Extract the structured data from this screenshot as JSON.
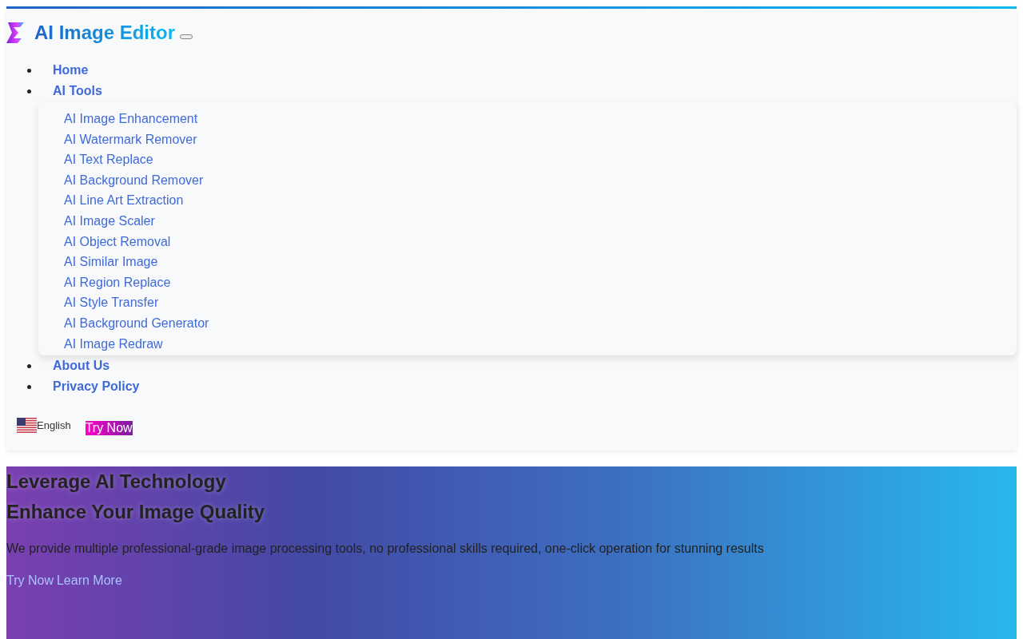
{
  "header": {
    "logo_text_parts": [
      "AI Image",
      "Editor"
    ],
    "nav": [
      {
        "label": "Home",
        "kind": "link"
      },
      {
        "label": "AI Tools",
        "kind": "menu",
        "expanded": true,
        "children": [
          "AI Image Enhancement",
          "AI Watermark Remover",
          "AI Text Replace",
          "AI Background Remover",
          "AI Line Art Extraction",
          "AI Image Scaler",
          "AI Object Removal",
          "AI Similar Image",
          "AI Region Replace",
          "AI Style Transfer",
          "AI Background Generator",
          "AI Image Redraw"
        ]
      },
      {
        "label": "About Us",
        "kind": "link"
      },
      {
        "label": "Privacy Policy",
        "kind": "link"
      }
    ],
    "language": "English",
    "cta": "Try Now"
  },
  "hero": {
    "titles": [
      "Leverage AI Technology",
      "Enhance Your Image Quality"
    ],
    "description": "We provide multiple professional-grade image processing tools, no professional skills required, one-click operation for stunning results",
    "links": [
      "Try Now",
      "Learn More"
    ]
  }
}
